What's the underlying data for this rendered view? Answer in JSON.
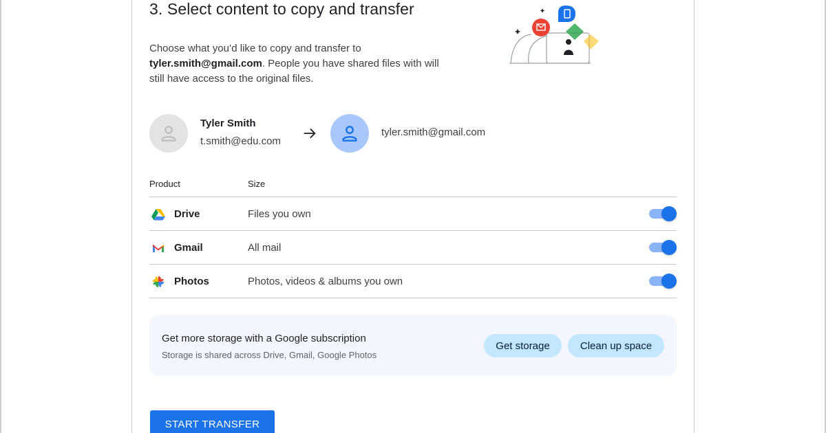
{
  "title": "3. Select content to copy and transfer",
  "description": {
    "before": "Choose what you’d like to copy and transfer to ",
    "email": "tyler.smith@gmail.com",
    "after": ". People you have shared files with will still have access to the original files."
  },
  "source_account": {
    "name": "Tyler Smith",
    "email": "t.smith@edu.com",
    "avatar_icon": "person-icon"
  },
  "destination_account": {
    "email": "tyler.smith@gmail.com",
    "avatar_icon": "person-icon"
  },
  "table": {
    "header_product": "Product",
    "header_size": "Size",
    "rows": [
      {
        "product": "Drive",
        "size": "Files you own",
        "icon": "google-drive-icon",
        "enabled": true
      },
      {
        "product": "Gmail",
        "size": "All mail",
        "icon": "gmail-icon",
        "enabled": true
      },
      {
        "product": "Photos",
        "size": "Photos, videos & albums you own",
        "icon": "google-photos-icon",
        "enabled": true
      }
    ]
  },
  "storage": {
    "title": "Get more storage with a Google subscription",
    "subtitle": "Storage is shared across Drive, Gmail, Google Photos",
    "get_storage_label": "Get storage",
    "clean_up_label": "Clean up space"
  },
  "start_button_label": "START TRANSFER",
  "colors": {
    "primary": "#1a73e8",
    "toggle_track": "#8ab4f8",
    "pill_bg": "#c2e7ff",
    "storage_bg": "#f3f6fc",
    "dest_avatar": "#a8c7fa"
  }
}
